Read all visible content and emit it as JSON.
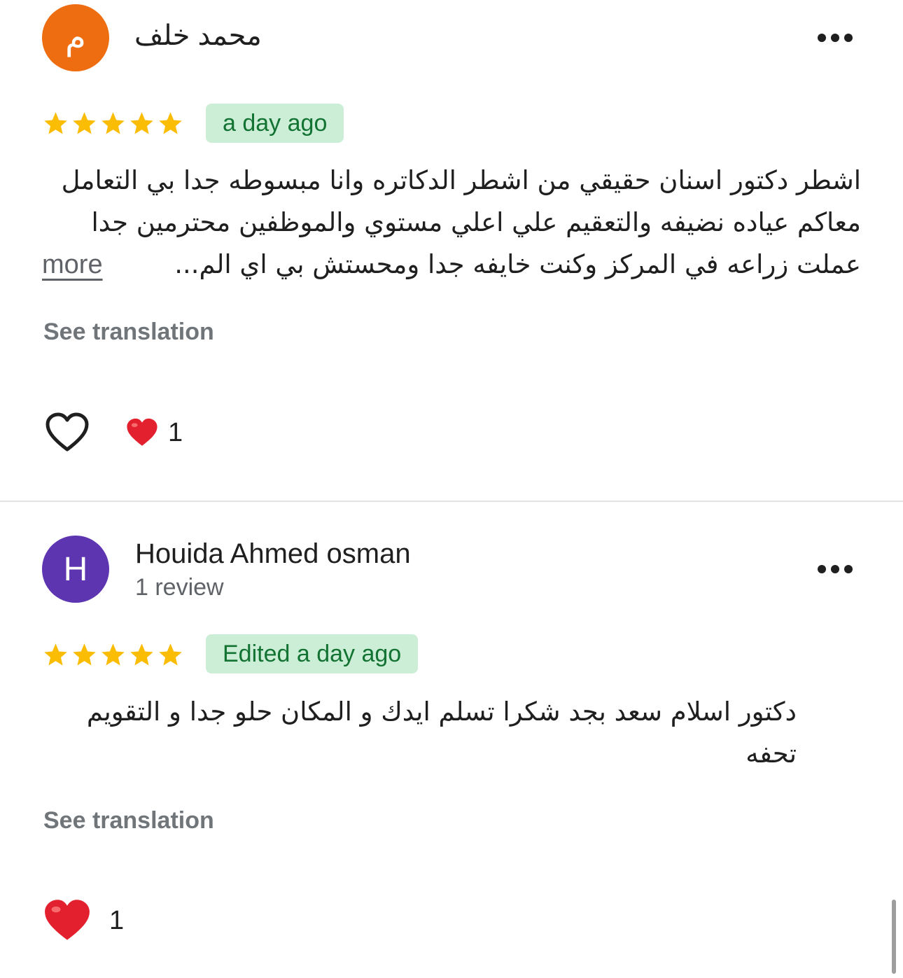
{
  "colors": {
    "avatar_orange": "#ee6d11",
    "avatar_purple": "#5e35b1",
    "star_gold": "#fbbc04",
    "badge_bg": "#cdeed6",
    "badge_text": "#137333",
    "heart_red": "#e3202d"
  },
  "reviews": [
    {
      "avatar_letter": "م",
      "author": "محمد خلف",
      "rating": 5,
      "date": "a day ago",
      "text_lines": [
        "اشطر دكتور اسنان حقيقي من اشطر الدكاتره وانا مبسوطه جدا بي التعامل",
        "معاكم عياده نضيفه والتعقيم علي اعلي مستوي والموظفين محترمين جدا",
        "عملت زراعه في المركز وكنت خايفه جدا ومحستش بي اي الم..."
      ],
      "more_label": "more",
      "see_translation": "See translation",
      "reaction_count": "1"
    },
    {
      "avatar_letter": "H",
      "author": "Houida Ahmed osman",
      "review_count": "1 review",
      "rating": 5,
      "date": "Edited a day ago",
      "text_lines": [
        "دكتور اسلام سعد بجد شكرا تسلم ايدك و المكان حلو جدا و التقويم",
        "تحفه"
      ],
      "see_translation": "See translation",
      "reaction_count": "1"
    }
  ]
}
